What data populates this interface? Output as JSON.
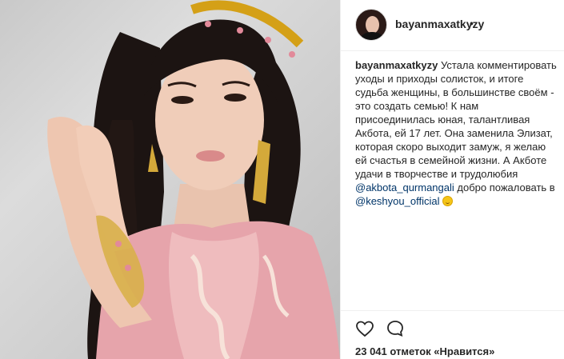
{
  "post": {
    "username": "bayanmaxatkyzy",
    "header_dot": "•",
    "caption": {
      "username": "bayanmaxatkyzy",
      "text_main": "Устала комментировать уходы и приходы солисток, и итоге судьба женщины, в большинстве своём - это создать семью! К нам присоединилась юная, талантливая Акбота, ей 17 лет. Она заменила Элизат, которая скоро выходит замуж, я желаю ей счастья в семейной жизни. А Акботе удачи в творчестве и трудолюбия ",
      "mention1": "@akbota_qurmangali",
      "text_mid": " добро пожаловать в ",
      "mention2": "@keshyou_official",
      "text_end": " "
    },
    "likes_text": "23 041 отметок «Нравится»"
  },
  "icons": {
    "like": "heart-icon",
    "comment": "comment-icon",
    "emoji": "smiling-face-emoji"
  },
  "colors": {
    "mention": "#003569",
    "text": "#262626",
    "border": "#efefef",
    "dress": "#e8a7ad"
  }
}
